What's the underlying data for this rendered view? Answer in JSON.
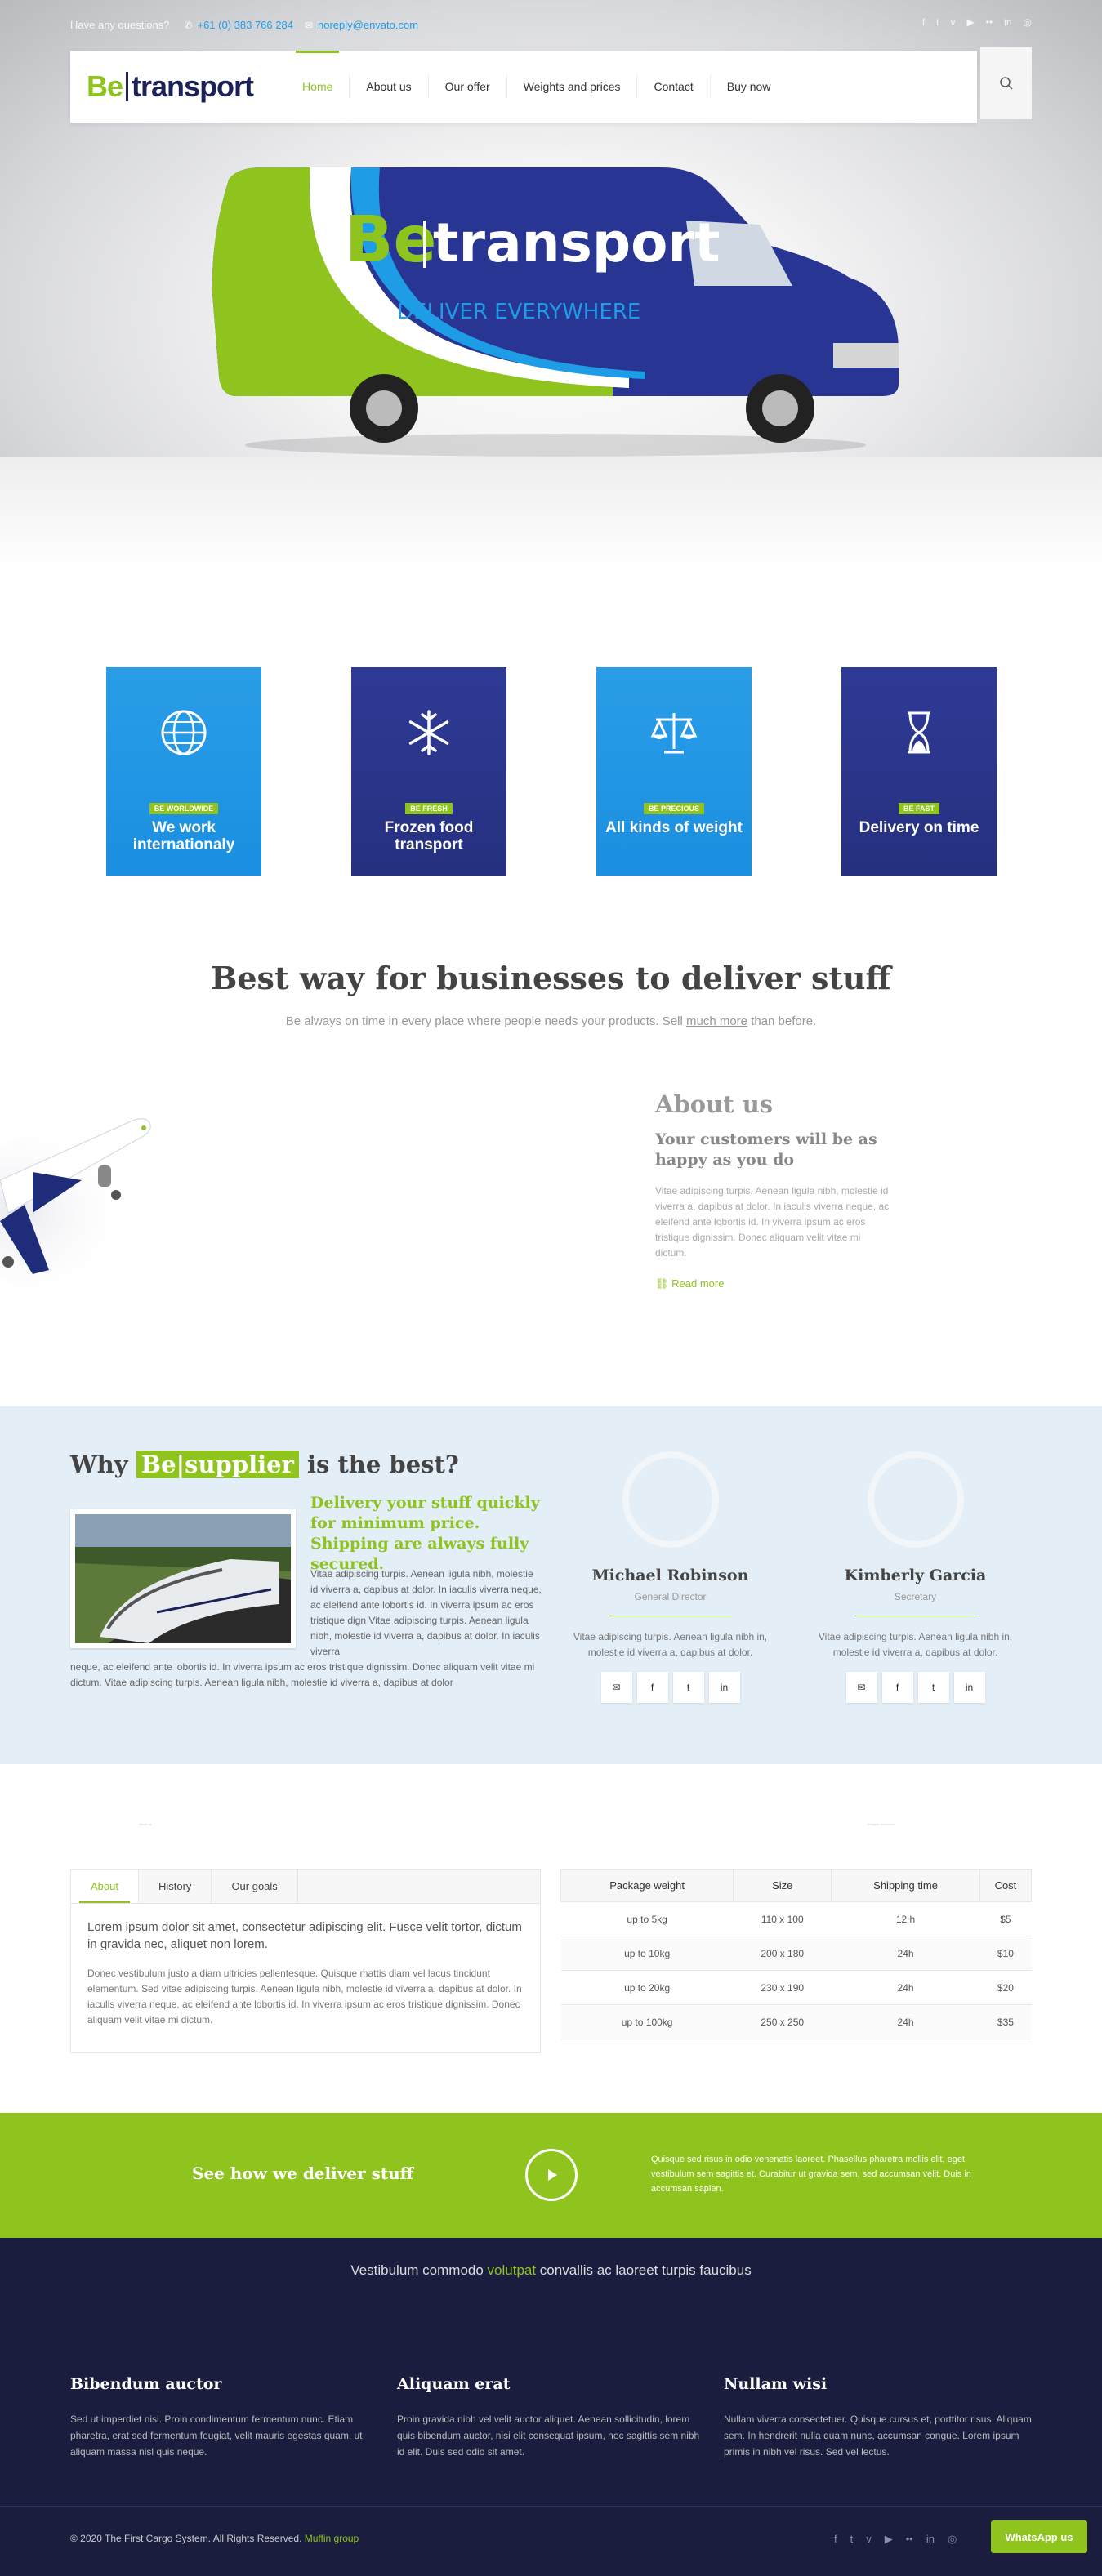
{
  "topbar": {
    "question": "Have any questions?",
    "phone": "+61 (0) 383 766 284",
    "email": "noreply@envato.com",
    "social_icons": [
      "facebook-icon",
      "twitter-icon",
      "vimeo-icon",
      "youtube-icon",
      "flickr-icon",
      "linkedin-icon",
      "dribbble-icon"
    ]
  },
  "logo": {
    "be": "Be",
    "text": "transport"
  },
  "nav": [
    "Home",
    "About us",
    "Our offer",
    "Weights and prices",
    "Contact",
    "Buy now"
  ],
  "van": {
    "brand_be": "Be",
    "brand_text": "transport",
    "slogan": "DELIVER EVERYWHERE"
  },
  "features": [
    {
      "tag": "BE WORLDWIDE",
      "title": "We work internationaly",
      "icon": "globe-icon"
    },
    {
      "tag": "BE FRESH",
      "title": "Frozen food transport",
      "icon": "snowflake-icon"
    },
    {
      "tag": "BE PRECIOUS",
      "title": "All kinds of weight",
      "icon": "scales-icon"
    },
    {
      "tag": "BE FAST",
      "title": "Delivery on time",
      "icon": "hourglass-icon"
    }
  ],
  "headline": {
    "title": "Best way for businesses to deliver stuff",
    "sub_pre": "Be always on time in every place where people needs your products. Sell ",
    "sub_u": "much more",
    "sub_post": " than before."
  },
  "about": {
    "title": "About us",
    "subtitle": "Your customers will be as happy as you do",
    "text": "Vitae adipiscing turpis. Aenean ligula nibh, molestie id viverra a, dapibus at dolor. In iaculis viverra neque, ac eleifend ante lobortis id. In viverra ipsum ac eros tristique dignissim. Donec aliquam velit vitae mi dictum.",
    "read_more": "Read more"
  },
  "why": {
    "title_pre": "Why ",
    "title_hl": "Be|supplier",
    "title_post": " is the best?",
    "lead": "Delivery your stuff quickly for minimum price. Shipping are always fully secured.",
    "body1": "Vitae adipiscing turpis. Aenean ligula nibh, molestie id viverra a, dapibus at dolor. In iaculis viverra neque, ac eleifend ante lobortis id. In viverra ipsum ac eros tristique dign Vitae adipiscing turpis. Aenean ligula nibh, molestie id viverra a, dapibus at dolor. In iaculis viverra",
    "body2": "neque, ac eleifend ante lobortis id. In viverra ipsum ac eros tristique dignissim. Donec aliquam velit vitae mi dictum. Vitae adipiscing turpis. Aenean ligula nibh, molestie id viverra a, dapibus at dolor",
    "people": [
      {
        "name": "Michael Robinson",
        "role": "General Director",
        "text": "Vitae adipiscing turpis. Aenean ligula nibh in, molestie id viverra a, dapibus at dolor."
      },
      {
        "name": "Kimberly Garcia",
        "role": "Secretary",
        "text": "Vitae adipiscing turpis. Aenean ligula nibh in, molestie id viverra a, dapibus at dolor."
      }
    ]
  },
  "tiny_left": "About us",
  "tiny_right": "Weights and prices",
  "tabs": {
    "labels": [
      "About",
      "History",
      "Our goals"
    ],
    "lead": "Lorem ipsum dolor sit amet, consectetur adipiscing elit. Fusce velit tortor, dictum in gravida nec, aliquet non lorem.",
    "text": "Donec vestibulum justo a diam ultricies pellentesque. Quisque mattis diam vel lacus tincidunt elementum. Sed vitae adipiscing turpis. Aenean ligula nibh, molestie id viverra a, dapibus at dolor. In iaculis viverra neque, ac eleifend ante lobortis id. In viverra ipsum ac eros tristique dignissim. Donec aliquam velit vitae mi dictum."
  },
  "price_table": {
    "headers": [
      "Package weight",
      "Size",
      "Shipping time",
      "Cost"
    ],
    "rows": [
      [
        "up to 5kg",
        "110 x 100",
        "12 h",
        "$5"
      ],
      [
        "up to 10kg",
        "200 x 180",
        "24h",
        "$10"
      ],
      [
        "up to 20kg",
        "230 x 190",
        "24h",
        "$20"
      ],
      [
        "up to 100kg",
        "250 x 250",
        "24h",
        "$35"
      ]
    ]
  },
  "green": {
    "title": "See how we deliver stuff",
    "text": "Quisque sed risus in odio venenatis laoreet. Phasellus pharetra mollis elit, eget vestibulum sem sagittis et. Curabitur ut gravida sem, sed accumsan velit. Duis in accumsan sapien."
  },
  "footer": {
    "tag_pre": "Vestibulum commodo ",
    "tag_hl": "volutpat",
    "tag_post": " convallis ac laoreet turpis faucibus",
    "cols": [
      {
        "title": "Bibendum auctor",
        "text": "Sed ut imperdiet nisi. Proin condimentum fermentum nunc. Etiam pharetra, erat sed fermentum feugiat, velit mauris egestas quam, ut aliquam massa nisl quis neque."
      },
      {
        "title": "Aliquam erat",
        "text": "Proin gravida nibh vel velit auctor aliquet. Aenean sollicitudin, lorem quis bibendum auctor, nisi elit consequat ipsum, nec sagittis sem nibh id elit. Duis sed odio sit amet."
      },
      {
        "title": "Nullam wisi",
        "text": "Nullam viverra consectetuer. Quisque cursus et, porttitor risus. Aliquam sem. In hendrerit nulla quam nunc, accumsan congue. Lorem ipsum primis in nibh vel risus. Sed vel lectus."
      }
    ],
    "copyright": "© 2020 The First Cargo System. All Rights Reserved. ",
    "copyright_link": "Muffin group",
    "whatsapp": "WhatsApp us"
  },
  "colors": {
    "accent": "#8ec41d",
    "navy": "#1c2158",
    "blue": "#1f9ce6",
    "footer": "#1a1d3e"
  }
}
